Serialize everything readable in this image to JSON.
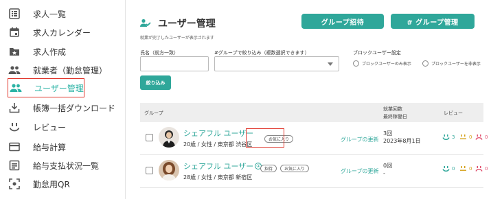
{
  "sidebar": {
    "items": [
      {
        "label": "求人一覧",
        "icon": "list-icon"
      },
      {
        "label": "求人カレンダー",
        "icon": "calendar-icon"
      },
      {
        "label": "求人作成",
        "icon": "folder-star-icon"
      },
      {
        "label": "就業者（勤怠管理）",
        "icon": "people-icon"
      },
      {
        "label": "ユーザー管理",
        "icon": "people-icon",
        "active": true
      },
      {
        "label": "帳簿一括ダウンロード",
        "icon": "download-icon"
      },
      {
        "label": "レビュー",
        "icon": "smile-icon"
      },
      {
        "label": "給与計算",
        "icon": "card-icon"
      },
      {
        "label": "給与支払状況一覧",
        "icon": "document-list-icon"
      },
      {
        "label": "勤怠用QR",
        "icon": "qr-scan-icon"
      }
    ]
  },
  "header": {
    "title": "ユーザー管理",
    "subtitle": "就業が完了したユーザーが表示されます",
    "invite_button": "グループ招待",
    "group_manage_button": "# グループ管理"
  },
  "filters": {
    "name_label": "氏名（前方一致）",
    "name_value": "",
    "group_label": "#グループで絞り込み（複数選択できます）",
    "group_value": "",
    "block_label": "ブロックユーザー設定",
    "block_only": "ブロックユーザーのみ表示",
    "block_hide": "ブロックユーザーを非表示",
    "filter_button": "絞り込み"
  },
  "table": {
    "headers": {
      "group": "グループ",
      "work_count": "就業回数",
      "last_work_date": "最終稼働日",
      "review": "レビュー"
    },
    "rows": [
      {
        "name": "シェアフル ユーザー",
        "badge": "",
        "detail": "20歳 / 女性 / 東京都 渋谷区",
        "tags": [
          "お気に入り"
        ],
        "group_update": "グループの更新",
        "work_count": "3回",
        "last_work_date": "2023年8月1日",
        "reviews": {
          "good": "3",
          "normal": "0",
          "bad": "0"
        }
      },
      {
        "name": "シェアフル ユーザー",
        "badge": "①",
        "detail": "28歳 / 女性 / 東京都 新宿区",
        "tags": [
          "招待",
          "お気に入り"
        ],
        "group_update": "グループの更新",
        "work_count": "0回",
        "last_work_date": "-",
        "reviews": {
          "good": "0",
          "normal": "0",
          "bad": "0"
        }
      }
    ]
  },
  "colors": {
    "accent": "#2fa79a",
    "good": "#2fa79a",
    "normal": "#d4a017",
    "bad": "#e0506e",
    "highlight": "#e0342a"
  }
}
